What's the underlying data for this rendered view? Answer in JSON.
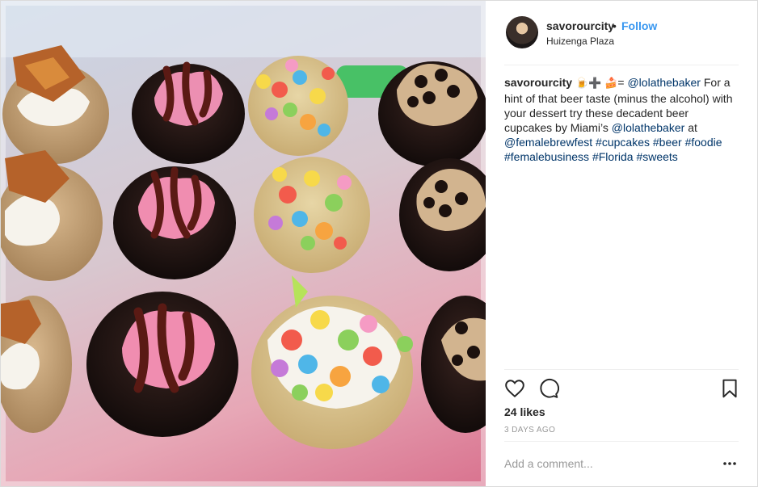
{
  "header": {
    "username": "savorourcity",
    "separator": "•",
    "follow_label": "Follow",
    "location": "Huizenga Plaza"
  },
  "caption": {
    "username": "savorourcity",
    "emoji_1": "🍺",
    "emoji_2": "➕",
    "emoji_3": "🍰",
    "equals": "=",
    "mention_1": "@lolathebaker",
    "text_1": "For a hint of that beer taste (minus the alcohol) with your dessert try these decadent beer cupcakes by Miami’s",
    "mention_2": "@lolathebaker",
    "text_2": "at",
    "hashtags": [
      "@femalebrewfest",
      "#cupcakes",
      "#beer",
      "#foodie",
      "#femalebusiness",
      "#Florida",
      "#sweets"
    ]
  },
  "actions": {
    "like_icon": "heart-icon",
    "comment_icon": "speech-bubble-icon",
    "save_icon": "bookmark-icon",
    "likes": "24 likes",
    "timestamp": "3 DAYS AGO"
  },
  "comment": {
    "placeholder": "Add a comment...",
    "more_icon": "ellipsis-icon"
  },
  "colors": {
    "link": "#003569",
    "follow": "#3897f0",
    "muted": "#999999",
    "border": "#dbdbdb"
  }
}
